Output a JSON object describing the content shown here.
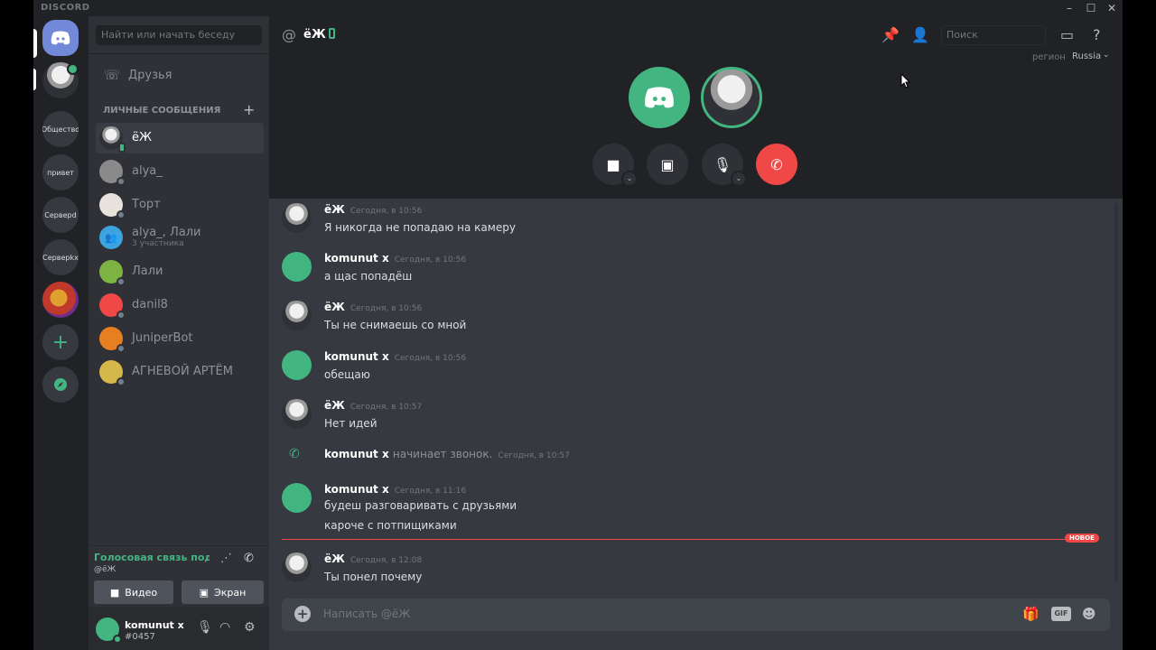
{
  "window": {
    "brand": "DISCORD"
  },
  "servers": [
    {
      "label": "Общество"
    },
    {
      "label": "привет"
    },
    {
      "label": "Серверd"
    },
    {
      "label": "Серверkx"
    }
  ],
  "sidebar": {
    "search_placeholder": "Найти или начать беседу",
    "friends_label": "Друзья",
    "dm_header": "ЛИЧНЫЕ СООБЩЕНИЯ",
    "dms": [
      {
        "name": "ёЖ"
      },
      {
        "name": "alya_"
      },
      {
        "name": "Торт"
      },
      {
        "name": "alya_, Лали",
        "sub": "3 участника"
      },
      {
        "name": "Лали"
      },
      {
        "name": "danil8"
      },
      {
        "name": "JuniperBot"
      },
      {
        "name": "АГНЕВОЙ АРТЁМ"
      }
    ]
  },
  "voice": {
    "status": "Голосовая связь подкл",
    "sub": "@ёЖ",
    "video_label": "Видео",
    "screen_label": "Экран"
  },
  "user": {
    "name": "komunut x",
    "tag": "#0457"
  },
  "header": {
    "at": "@",
    "name": "ёЖ",
    "search_placeholder": "Поиск",
    "region_label": "регион",
    "region_value": "Russia"
  },
  "messages": [
    {
      "author": "ёЖ",
      "time": "Сегодня, в 10:56",
      "text": "Я никогда не попадаю на камеру"
    },
    {
      "author": "komunut x",
      "time": "Сегодня, в 10:56",
      "text": "а щас попадёш"
    },
    {
      "author": "ёЖ",
      "time": "Сегодня, в 10:56",
      "text": "Ты не снимаешь со мной"
    },
    {
      "author": "komunut x",
      "time": "Сегодня, в 10:56",
      "text": "обещаю"
    },
    {
      "author": "ёЖ",
      "time": "Сегодня, в 10:57",
      "text": "Нет идей"
    },
    {
      "author": "komunut x",
      "time": "Сегодня, в 11:16",
      "text": "будеш разговаривать с друзьями",
      "text2": "кароче с потпищиками"
    },
    {
      "author": "ёЖ",
      "time": "Сегодня, в 12:08",
      "text": "Ты понел почему"
    }
  ],
  "system_call": {
    "author": "komunut x",
    "action": "начинает звонок.",
    "time": "Сегодня, в 10:57"
  },
  "new_badge": "НОВОЕ",
  "composer": {
    "placeholder": "Написать @ёЖ",
    "gif_label": "GIF"
  },
  "colors": {
    "accent": "#7289da",
    "online": "#43b581",
    "danger": "#f04747"
  }
}
